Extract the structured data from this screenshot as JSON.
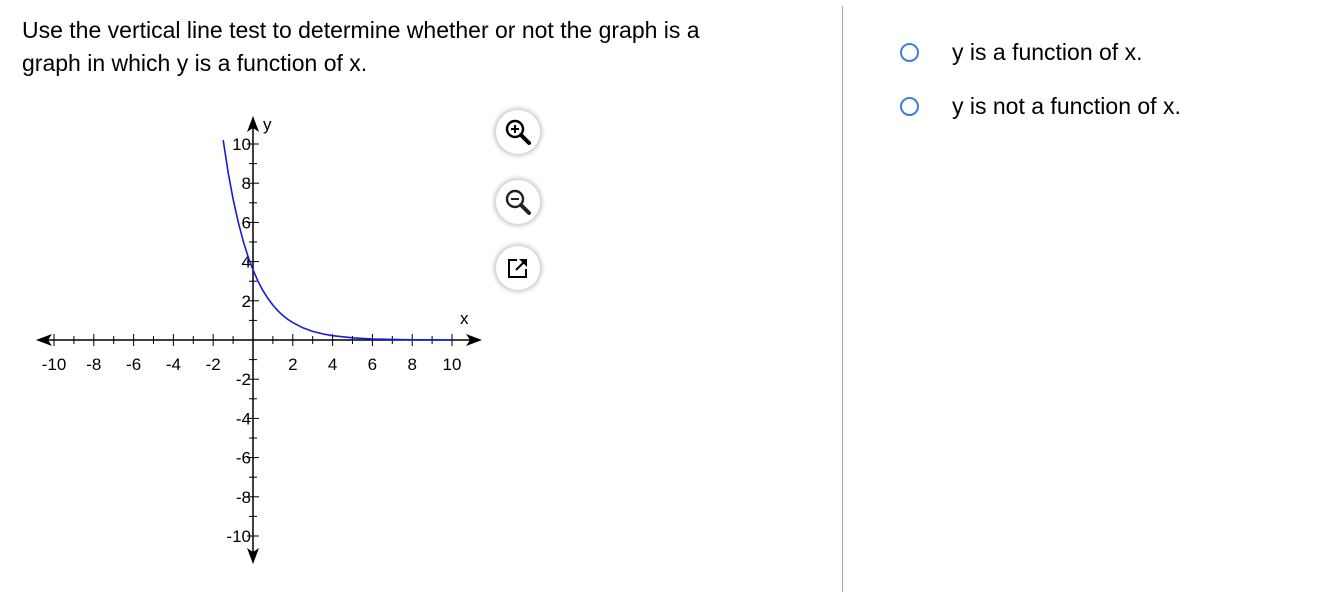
{
  "question": {
    "line1": "Use the vertical line test to determine whether or not the graph is a",
    "line2": "graph in which y is a function of x."
  },
  "graph": {
    "x_axis_label": "x",
    "y_axis_label": "y",
    "x_ticks": [
      -10,
      -8,
      -6,
      -4,
      -2,
      2,
      4,
      6,
      8,
      10
    ],
    "y_ticks": [
      10,
      8,
      6,
      4,
      2,
      -2,
      -4,
      -6,
      -8,
      -10
    ],
    "x_range": [
      -10,
      10
    ],
    "y_range": [
      -10,
      10
    ],
    "curve_color": "#1a1adb",
    "curve_points": [
      [
        -1.5,
        10.2
      ],
      [
        -1.25,
        8.56
      ],
      [
        -1.0,
        7.19
      ],
      [
        -0.75,
        6.04
      ],
      [
        -0.5,
        5.07
      ],
      [
        -0.25,
        4.26
      ],
      [
        0.0,
        3.58
      ],
      [
        0.25,
        3.0
      ],
      [
        0.5,
        2.52
      ],
      [
        0.75,
        2.12
      ],
      [
        1.0,
        1.78
      ],
      [
        1.25,
        1.49
      ],
      [
        1.5,
        1.25
      ],
      [
        1.75,
        1.05
      ],
      [
        2.0,
        0.89
      ],
      [
        2.5,
        0.62
      ],
      [
        3.0,
        0.44
      ],
      [
        3.5,
        0.31
      ],
      [
        4.0,
        0.22
      ],
      [
        5.0,
        0.11
      ],
      [
        6.0,
        0.05
      ],
      [
        7.0,
        0.03
      ],
      [
        8.0,
        0.01
      ],
      [
        9.0,
        0.01
      ],
      [
        10.0,
        0.0
      ]
    ]
  },
  "tools": {
    "zoom_in": "zoom-in-icon",
    "zoom_out": "zoom-out-icon",
    "popout": "popout-icon"
  },
  "options": [
    {
      "label": "y is a function of x."
    },
    {
      "label": "y is not a function of x."
    }
  ],
  "colors": {
    "radio_border": "#3c7fd8",
    "divider": "#a9a9a9",
    "axis": "#000000"
  }
}
